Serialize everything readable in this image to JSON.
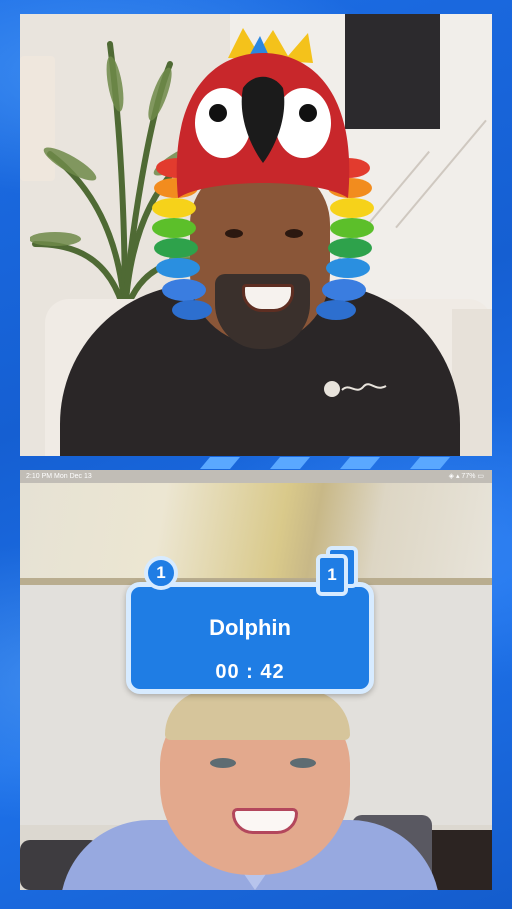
{
  "status_bar": {
    "time": "2:10 PM  Mon Dec 13",
    "right": "◈ ▴ 77% ▭"
  },
  "game_card": {
    "word": "Dolphin",
    "timer": "00 : 42",
    "score": "1",
    "cards_count": "1"
  },
  "colors": {
    "frame_blue": "#1a63d6",
    "card_blue": "#1f7de4",
    "card_border": "#d7ebff"
  }
}
